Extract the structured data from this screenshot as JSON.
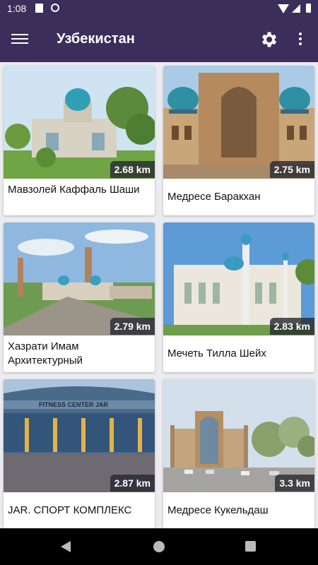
{
  "status_bar": {
    "time": "1:08"
  },
  "app_bar": {
    "title": "Узбекистан"
  },
  "cards": [
    {
      "name": "Мавзолей Каффаль Шаши",
      "distance": "2.68 km"
    },
    {
      "name": "Медресе Баракхан",
      "distance": "2.75 km"
    },
    {
      "name": "Хазрати Имам Архитектурный",
      "distance": "2.79 km"
    },
    {
      "name": "Мечеть Тилла Шейх",
      "distance": "2.83 km"
    },
    {
      "name": "JAR. СПОРТ КОМПЛЕКС",
      "distance": "2.87 km"
    },
    {
      "name": "Медресе Кукельдаш",
      "distance": "3.3 km"
    }
  ],
  "photo_signs": {
    "jar_sign": "FITNESS CENTER JAR"
  },
  "colors": {
    "primary": "#3b2e5a",
    "badge": "#28283a"
  },
  "icons": [
    "menu-icon",
    "settings-icon",
    "more-vert-icon",
    "back-icon",
    "home-icon",
    "recents-icon"
  ]
}
